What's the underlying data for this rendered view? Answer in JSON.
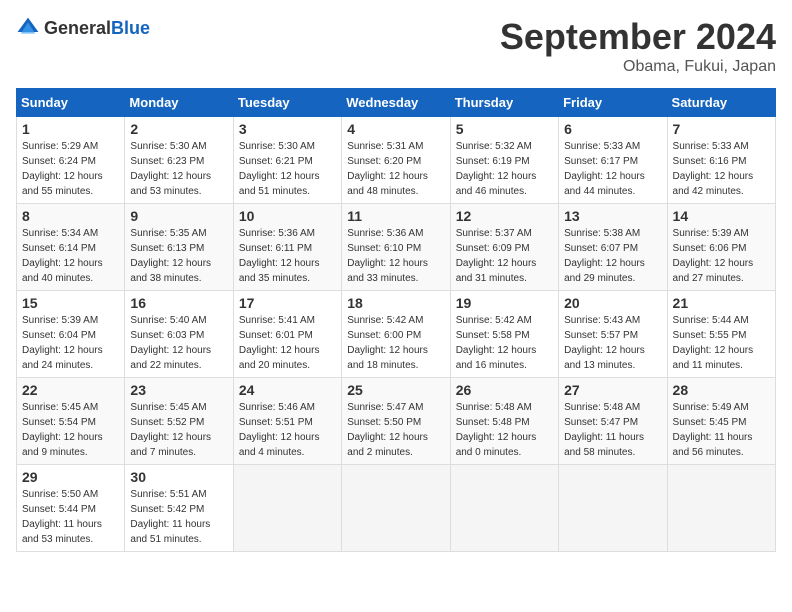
{
  "logo": {
    "general": "General",
    "blue": "Blue"
  },
  "header": {
    "month": "September 2024",
    "location": "Obama, Fukui, Japan"
  },
  "weekdays": [
    "Sunday",
    "Monday",
    "Tuesday",
    "Wednesday",
    "Thursday",
    "Friday",
    "Saturday"
  ],
  "weeks": [
    [
      {
        "day": "1",
        "sunrise": "5:29 AM",
        "sunset": "6:24 PM",
        "daylight": "12 hours and 55 minutes."
      },
      {
        "day": "2",
        "sunrise": "5:30 AM",
        "sunset": "6:23 PM",
        "daylight": "12 hours and 53 minutes."
      },
      {
        "day": "3",
        "sunrise": "5:30 AM",
        "sunset": "6:21 PM",
        "daylight": "12 hours and 51 minutes."
      },
      {
        "day": "4",
        "sunrise": "5:31 AM",
        "sunset": "6:20 PM",
        "daylight": "12 hours and 48 minutes."
      },
      {
        "day": "5",
        "sunrise": "5:32 AM",
        "sunset": "6:19 PM",
        "daylight": "12 hours and 46 minutes."
      },
      {
        "day": "6",
        "sunrise": "5:33 AM",
        "sunset": "6:17 PM",
        "daylight": "12 hours and 44 minutes."
      },
      {
        "day": "7",
        "sunrise": "5:33 AM",
        "sunset": "6:16 PM",
        "daylight": "12 hours and 42 minutes."
      }
    ],
    [
      {
        "day": "8",
        "sunrise": "5:34 AM",
        "sunset": "6:14 PM",
        "daylight": "12 hours and 40 minutes."
      },
      {
        "day": "9",
        "sunrise": "5:35 AM",
        "sunset": "6:13 PM",
        "daylight": "12 hours and 38 minutes."
      },
      {
        "day": "10",
        "sunrise": "5:36 AM",
        "sunset": "6:11 PM",
        "daylight": "12 hours and 35 minutes."
      },
      {
        "day": "11",
        "sunrise": "5:36 AM",
        "sunset": "6:10 PM",
        "daylight": "12 hours and 33 minutes."
      },
      {
        "day": "12",
        "sunrise": "5:37 AM",
        "sunset": "6:09 PM",
        "daylight": "12 hours and 31 minutes."
      },
      {
        "day": "13",
        "sunrise": "5:38 AM",
        "sunset": "6:07 PM",
        "daylight": "12 hours and 29 minutes."
      },
      {
        "day": "14",
        "sunrise": "5:39 AM",
        "sunset": "6:06 PM",
        "daylight": "12 hours and 27 minutes."
      }
    ],
    [
      {
        "day": "15",
        "sunrise": "5:39 AM",
        "sunset": "6:04 PM",
        "daylight": "12 hours and 24 minutes."
      },
      {
        "day": "16",
        "sunrise": "5:40 AM",
        "sunset": "6:03 PM",
        "daylight": "12 hours and 22 minutes."
      },
      {
        "day": "17",
        "sunrise": "5:41 AM",
        "sunset": "6:01 PM",
        "daylight": "12 hours and 20 minutes."
      },
      {
        "day": "18",
        "sunrise": "5:42 AM",
        "sunset": "6:00 PM",
        "daylight": "12 hours and 18 minutes."
      },
      {
        "day": "19",
        "sunrise": "5:42 AM",
        "sunset": "5:58 PM",
        "daylight": "12 hours and 16 minutes."
      },
      {
        "day": "20",
        "sunrise": "5:43 AM",
        "sunset": "5:57 PM",
        "daylight": "12 hours and 13 minutes."
      },
      {
        "day": "21",
        "sunrise": "5:44 AM",
        "sunset": "5:55 PM",
        "daylight": "12 hours and 11 minutes."
      }
    ],
    [
      {
        "day": "22",
        "sunrise": "5:45 AM",
        "sunset": "5:54 PM",
        "daylight": "12 hours and 9 minutes."
      },
      {
        "day": "23",
        "sunrise": "5:45 AM",
        "sunset": "5:52 PM",
        "daylight": "12 hours and 7 minutes."
      },
      {
        "day": "24",
        "sunrise": "5:46 AM",
        "sunset": "5:51 PM",
        "daylight": "12 hours and 4 minutes."
      },
      {
        "day": "25",
        "sunrise": "5:47 AM",
        "sunset": "5:50 PM",
        "daylight": "12 hours and 2 minutes."
      },
      {
        "day": "26",
        "sunrise": "5:48 AM",
        "sunset": "5:48 PM",
        "daylight": "12 hours and 0 minutes."
      },
      {
        "day": "27",
        "sunrise": "5:48 AM",
        "sunset": "5:47 PM",
        "daylight": "11 hours and 58 minutes."
      },
      {
        "day": "28",
        "sunrise": "5:49 AM",
        "sunset": "5:45 PM",
        "daylight": "11 hours and 56 minutes."
      }
    ],
    [
      {
        "day": "29",
        "sunrise": "5:50 AM",
        "sunset": "5:44 PM",
        "daylight": "11 hours and 53 minutes."
      },
      {
        "day": "30",
        "sunrise": "5:51 AM",
        "sunset": "5:42 PM",
        "daylight": "11 hours and 51 minutes."
      },
      null,
      null,
      null,
      null,
      null
    ]
  ],
  "labels": {
    "sunrise": "Sunrise:",
    "sunset": "Sunset:",
    "daylight": "Daylight:"
  }
}
